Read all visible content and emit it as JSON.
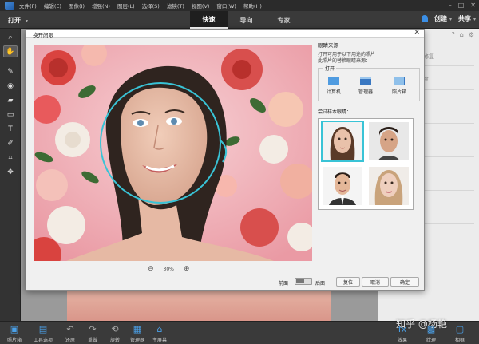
{
  "menu": [
    "文件(F)",
    "编辑(E)",
    "图像(I)",
    "增强(N)",
    "图层(L)",
    "选择(S)",
    "滤镜(T)",
    "视图(V)",
    "窗口(W)",
    "帮助(H)"
  ],
  "window_controls": {
    "minimize": "–",
    "maximize": "□",
    "close": "✕"
  },
  "toolbar_top": {
    "open_label": "打开",
    "open_caret": "▾",
    "create_label": "创建",
    "share_label": "共享",
    "caret": "▾"
  },
  "modes": [
    "快速",
    "导向",
    "专家"
  ],
  "active_mode": "快速",
  "dialog": {
    "title": "换开闭眼",
    "close": "✕",
    "side_header": "眼睛来源",
    "side_desc": "打开可用于以下用途的照片\n此照片的替换眼睛来源：",
    "open_group": "打开",
    "sources": [
      "计算机",
      "管理器",
      "照片箱"
    ],
    "sample_header": "尝试样本眼睛：",
    "zoom_value": "30%",
    "zoom_out": "⊖",
    "zoom_in": "⊕",
    "toggle_before": "前面",
    "toggle_after": "后面",
    "buttons": {
      "reset": "复位",
      "cancel": "取消",
      "ok": "确定"
    }
  },
  "right_panel": {
    "items": [
      "修复",
      "度",
      "",
      ""
    ],
    "icons": [
      "?",
      "⌂",
      "⚙"
    ]
  },
  "bottom_bar": {
    "left": [
      {
        "label": "照片箱",
        "icon": "photo-bin-icon"
      },
      {
        "label": "工具选项",
        "icon": "tool-options-icon"
      },
      {
        "label": "还原",
        "icon": "undo-icon"
      },
      {
        "label": "重做",
        "icon": "redo-icon"
      },
      {
        "label": "旋转",
        "icon": "rotate-icon"
      },
      {
        "label": "管理器",
        "icon": "organizer-icon"
      },
      {
        "label": "主屏幕",
        "icon": "home-icon"
      }
    ],
    "right": [
      {
        "label": "效果",
        "icon": "effects-icon"
      },
      {
        "label": "纹理",
        "icon": "textures-icon"
      },
      {
        "label": "相框",
        "icon": "frames-icon"
      }
    ]
  },
  "watermark": "知乎 @杨艳",
  "colors": {
    "accent": "#39c3d6",
    "brand": "#3b8fe6",
    "active_tab": "#1f1f1f"
  }
}
